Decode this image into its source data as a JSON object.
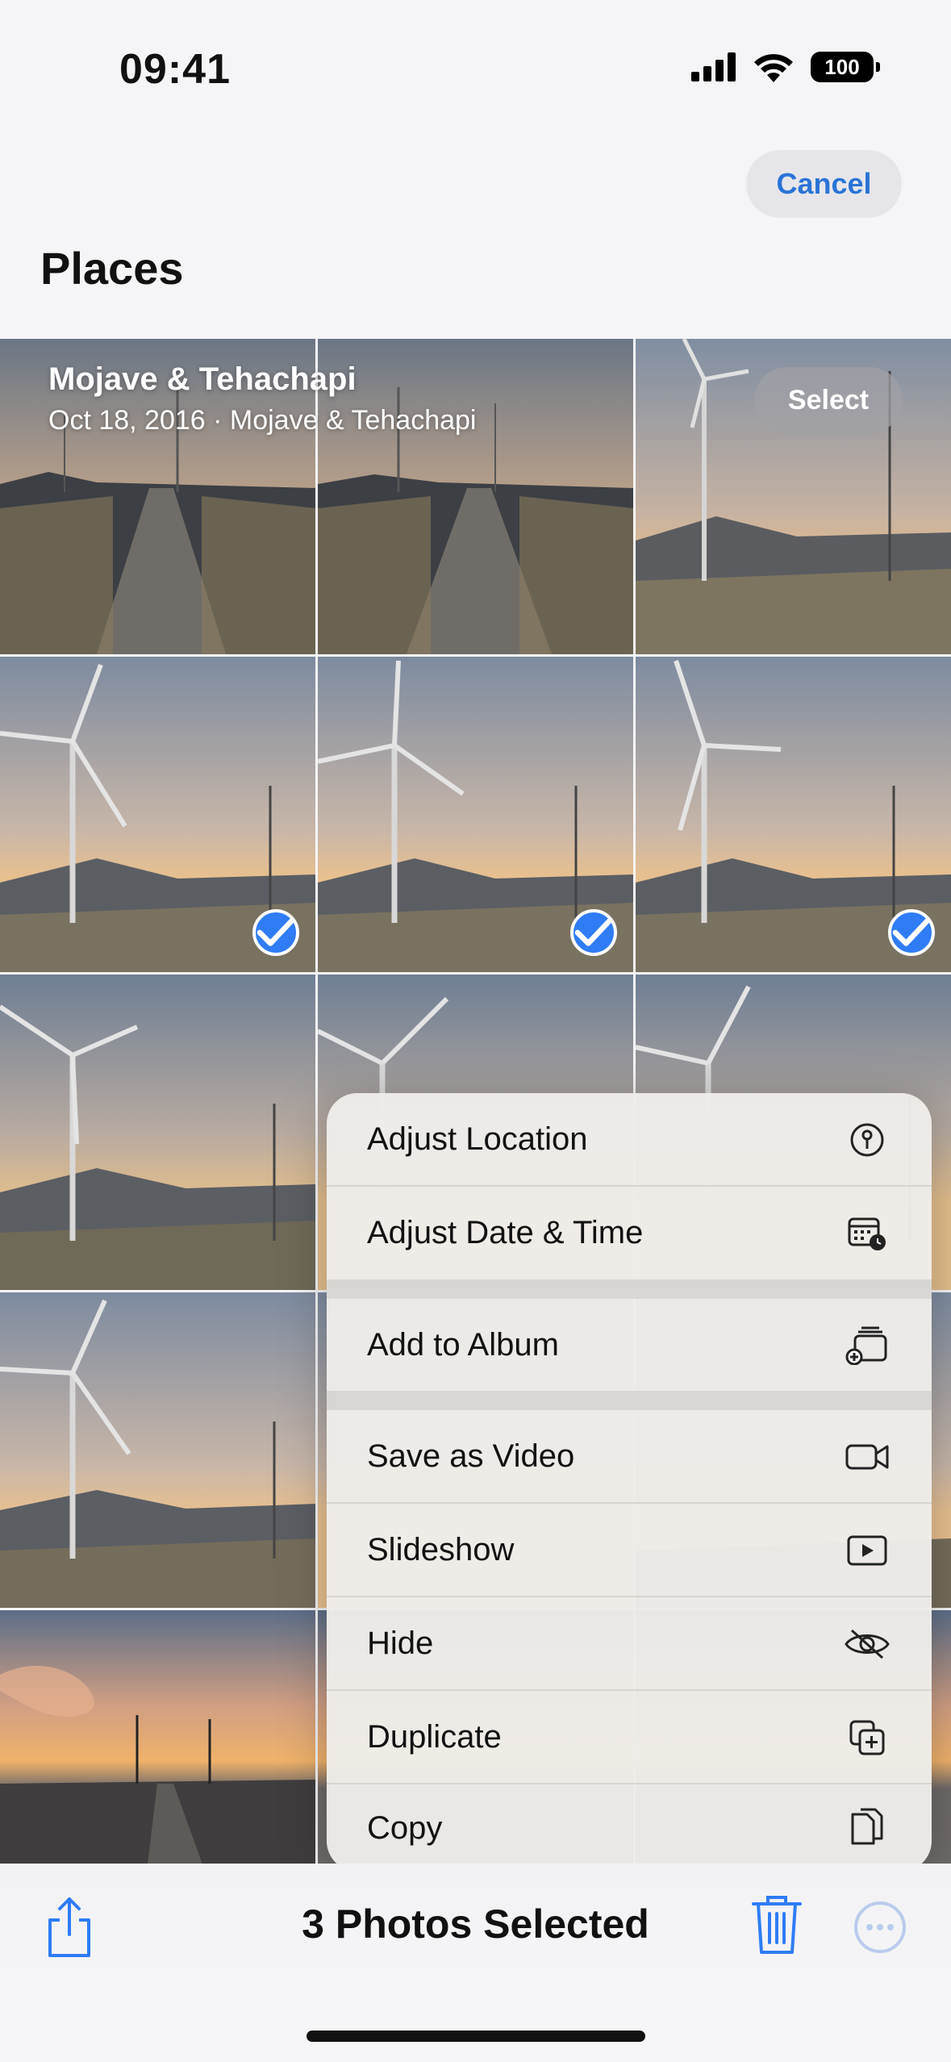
{
  "status_bar": {
    "time": "09:41",
    "battery": "100"
  },
  "header": {
    "cancel_label": "Cancel",
    "title": "Places"
  },
  "group": {
    "title": "Mojave & Tehachapi",
    "subtitle": "Oct 18, 2016  ·  Mojave & Tehachapi",
    "select_label": "Select"
  },
  "menu": {
    "items": [
      {
        "label": "Adjust Location",
        "icon": "location-pin-icon"
      },
      {
        "label": "Adjust Date & Time",
        "icon": "calendar-clock-icon"
      },
      {
        "label": "Add to Album",
        "icon": "add-to-album-icon"
      },
      {
        "label": "Save as Video",
        "icon": "video-camera-icon"
      },
      {
        "label": "Slideshow",
        "icon": "play-rectangle-icon"
      },
      {
        "label": "Hide",
        "icon": "eye-slash-icon"
      },
      {
        "label": "Duplicate",
        "icon": "duplicate-icon"
      },
      {
        "label": "Copy",
        "icon": "copy-icon"
      }
    ]
  },
  "toolbar": {
    "selection_text": "3 Photos Selected"
  },
  "colors": {
    "accent": "#2f7cf6",
    "link": "#2a74d6"
  }
}
